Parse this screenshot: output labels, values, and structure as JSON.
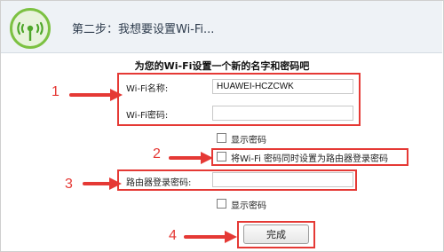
{
  "header": {
    "title": "第二步：我想要设置Wi-Fi..."
  },
  "main": {
    "heading": "为您的Wi-Fi设置一个新的名字和密码吧",
    "wifi_name_label": "Wi-Fi名称:",
    "wifi_name_value": "HUAWEI-HCZCWK",
    "wifi_password_label": "Wi-Fi密码:",
    "wifi_password_value": "",
    "show_password_label_1": "显示密码",
    "same_as_router_label": "将Wi-Fi 密码同时设置为路由器登录密码",
    "router_password_label": "路由器登录密码:",
    "router_password_value": "",
    "show_password_label_2": "显示密码",
    "finish_button": "完成"
  },
  "annotations": {
    "n1": "1",
    "n2": "2",
    "n3": "3",
    "n4": "4",
    "color": "#e53935"
  },
  "icons": {
    "logo": "wifi-logo-icon"
  }
}
